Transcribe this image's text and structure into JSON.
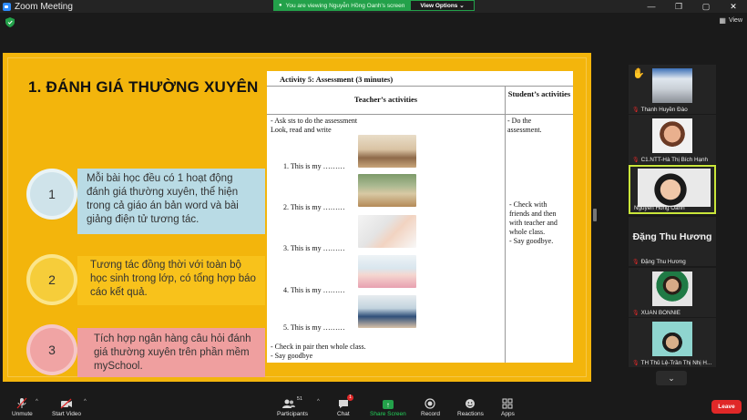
{
  "window": {
    "title": "Zoom Meeting",
    "controls": {
      "minimize": "—",
      "restore": "❐",
      "maximize": "▢",
      "close": "✕"
    }
  },
  "share_banner": {
    "viewing_text": "You are viewing Nguyễn Hồng Oanh's screen",
    "view_options": "View Options ⌄"
  },
  "top_right": {
    "view_label": "View"
  },
  "slide": {
    "title": "1. ĐÁNH GIÁ THƯỜNG XUYÊN",
    "items": [
      {
        "number": "1",
        "text": "Mỗi bài học đều có 1 hoạt động đánh giá thường xuyên, thể hiện trong cả giáo án bản word và bài giảng điện tử tương tác."
      },
      {
        "number": "2",
        "text": "Tương tác đồng thời với toàn bộ học sinh trong lớp, có tổng hợp báo cáo kết quả."
      },
      {
        "number": "3",
        "text": "Tích hợp ngân hàng câu hỏi đánh giá thường xuyên trên phần mềm mySchool."
      }
    ],
    "colors": {
      "background": "#f3b50c",
      "item1": "#b9dbe5",
      "item2": "#f8c21b",
      "item3": "#ef9f9f"
    }
  },
  "document": {
    "activity": "Activity 5: Assessment (3 minutes)",
    "header_teacher": "Teacher’s activities",
    "header_student": "Student’s activities",
    "teacher_intro": [
      "- Ask sts to do the assessment",
      "Look, read and write"
    ],
    "exercises": [
      "1.    This is my ………",
      "2.    This is my ………",
      "3.    This is my ………",
      "4.    This is my ………",
      "5.    This is my ………"
    ],
    "teacher_outro": [
      "- Check in pair then whole class.",
      "- Say goodbye"
    ],
    "student_top": [
      " - Do the",
      "assessment."
    ],
    "student_mid": [
      "- Check with",
      "friends and then",
      "with teacher and",
      "whole class.",
      "- Say goodbye."
    ]
  },
  "participants": [
    {
      "name": "Thanh Huyền Đào",
      "hand_raised": "✋"
    },
    {
      "name": "C1.NTT-Hà Thị Bích Hạnh"
    },
    {
      "name": "Nguyễn Hồng Oanh",
      "active": true
    },
    {
      "name": "Đặng Thu Hương",
      "display_name": "Đặng Thu Hương"
    },
    {
      "name": "XUAN BONNIE"
    },
    {
      "name": "TH Thủ Lệ-Trần Thị Nhị H..."
    }
  ],
  "toolbar": {
    "unmute": "Unmute",
    "start_video": "Start Video",
    "participants": "Participants",
    "participants_count": "51",
    "chat": "Chat",
    "chat_badge": "1",
    "share_screen": "Share Screen",
    "record": "Record",
    "reactions": "Reactions",
    "apps": "Apps",
    "leave": "Leave"
  },
  "icons": {
    "mic": "mic-muted-icon",
    "video": "video-off-icon",
    "participants": "people-icon",
    "chat": "chat-icon",
    "share": "share-screen-icon",
    "record": "record-icon",
    "reactions": "smiley-icon",
    "apps": "apps-icon"
  }
}
